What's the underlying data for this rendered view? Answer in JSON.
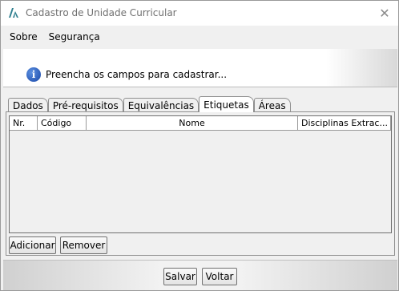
{
  "window": {
    "title": "Cadastro de Unidade Curricular",
    "close_glyph": "✕"
  },
  "menu": {
    "items": [
      {
        "label": "Sobre"
      },
      {
        "label": "Segurança"
      }
    ]
  },
  "info": {
    "icon": "info-icon",
    "icon_glyph": "i",
    "message": "Preencha os campos para cadastrar..."
  },
  "tabs": [
    {
      "label": "Dados"
    },
    {
      "label": "Pré-requisitos"
    },
    {
      "label": "Equivalências"
    },
    {
      "label": "Etiquetas",
      "active": true
    },
    {
      "label": "Áreas"
    }
  ],
  "table": {
    "columns": [
      "Nr.",
      "Código",
      "Nome",
      "Disciplinas Extrac..."
    ],
    "rows": []
  },
  "actions": {
    "add_label": "Adicionar",
    "remove_label": "Remover"
  },
  "footer": {
    "save_label": "Salvar",
    "back_label": "Voltar"
  },
  "colors": {
    "app_icon": "#2f7f8f",
    "info_icon": "#1a48a8"
  }
}
